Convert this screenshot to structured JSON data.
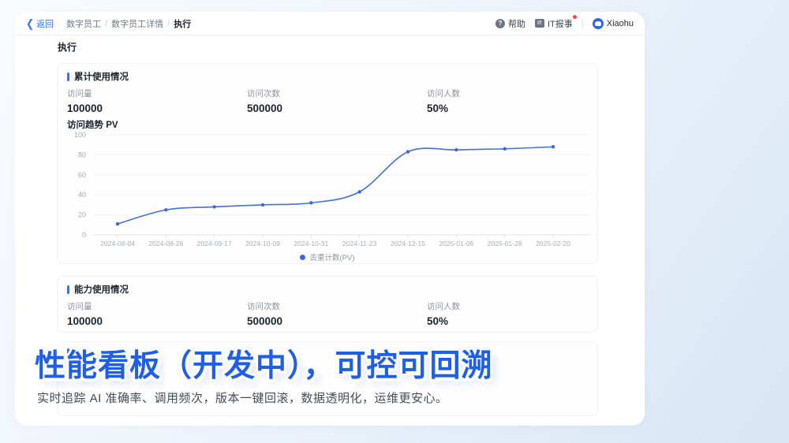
{
  "nav": {
    "back_label": "返回",
    "breadcrumb": [
      "数字员工",
      "数字员工详情",
      "执行"
    ],
    "help_label": "帮助",
    "it_report_label": "IT报事",
    "user_name": "Xiaohu"
  },
  "page": {
    "title": "执行"
  },
  "cards": [
    {
      "section": "累计使用情况",
      "stats": [
        {
          "label": "访问量",
          "value": "100000"
        },
        {
          "label": "访问次数",
          "value": "500000"
        },
        {
          "label": "访问人数",
          "value": "50%"
        }
      ]
    },
    {
      "section": "能力使用情况",
      "stats": [
        {
          "label": "访问量",
          "value": "100000"
        },
        {
          "label": "访问次数",
          "value": "500000"
        },
        {
          "label": "访问人数",
          "value": "50%"
        }
      ]
    }
  ],
  "chart_data": {
    "type": "line",
    "title": "访问趋势 PV",
    "categories": [
      "2024-08-04",
      "2024-08-26",
      "2024-09-17",
      "2024-10-09",
      "2024-10-31",
      "2024-11-23",
      "2024-12-15",
      "2025-01-06",
      "2025-01-28",
      "2025-02-20"
    ],
    "series": [
      {
        "name": "去重计数(PV)",
        "values": [
          11,
          25,
          28,
          30,
          32,
          43,
          83,
          85,
          86,
          88
        ]
      }
    ],
    "xlabel": "",
    "ylabel": "",
    "ylim": [
      0,
      100
    ],
    "ytick_step": 20,
    "grid": true,
    "legend_position": "bottom",
    "line_color": "#436fe0",
    "marker_color": "#3e68dc"
  },
  "hero": {
    "title": "性能看板（开发中），可控可回溯",
    "subtitle": "实时追踪 AI 准确率、调用频次，版本一键回滚，数据透明化，运维更安心。"
  },
  "colors": {
    "accent": "#3370ff",
    "title_blue": "#1f5fe8",
    "badge_red": "#f54a45"
  }
}
